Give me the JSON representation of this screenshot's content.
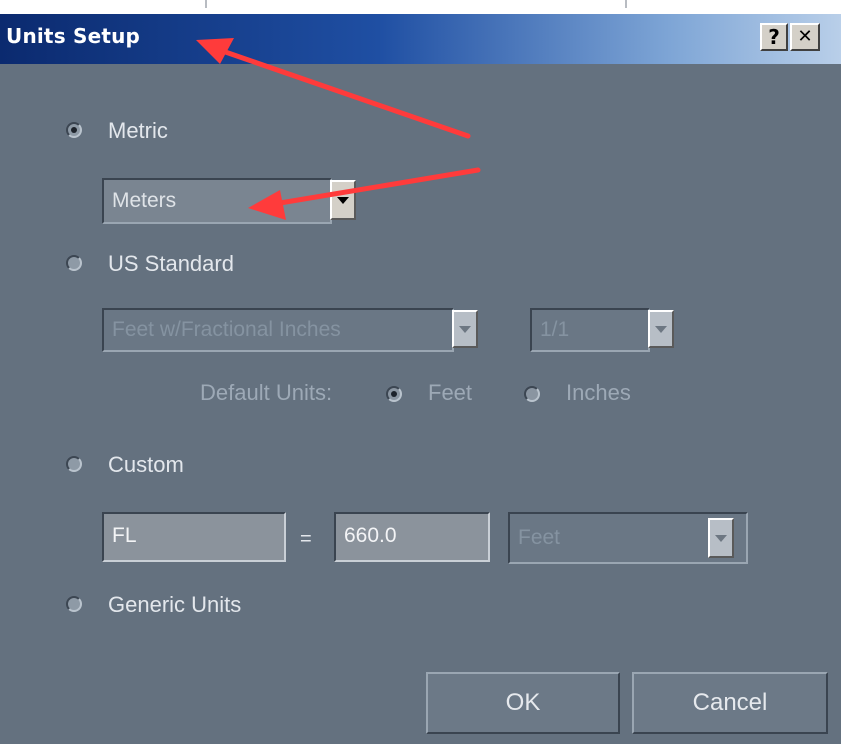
{
  "window": {
    "title": "Units Setup",
    "help_button": "?",
    "close_button": "✕"
  },
  "metric": {
    "label": "Metric",
    "selected": true,
    "unit_value": "Meters"
  },
  "us_standard": {
    "label": "US Standard",
    "selected": false,
    "unit_value": "Feet w/Fractional Inches",
    "fraction_value": "1/1",
    "default_units_label": "Default Units:",
    "feet_label": "Feet",
    "inches_label": "Inches",
    "feet_selected": true
  },
  "custom": {
    "label": "Custom",
    "selected": false,
    "name_value": "FL",
    "equals": "=",
    "amount_value": "660.0",
    "unit_value": "Feet"
  },
  "generic": {
    "label": "Generic Units",
    "selected": false
  },
  "buttons": {
    "ok": "OK",
    "cancel": "Cancel"
  },
  "colors": {
    "dialog_background": "#64717f",
    "annotation_arrow": "#ff3b3b"
  },
  "icons": {
    "help": "question-mark-icon",
    "close": "close-icon",
    "dropdown": "chevron-down-icon"
  }
}
